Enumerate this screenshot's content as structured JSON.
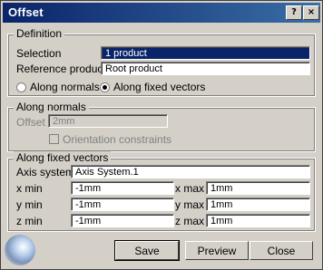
{
  "window": {
    "title": "Offset",
    "help_label": "?",
    "close_label": "×"
  },
  "definition": {
    "group_title": "Definition",
    "selection_label": "Selection",
    "selection_value": "1 product",
    "reference_label": "Reference product",
    "reference_value": "Root product",
    "radio_normals_label": "Along normals",
    "radio_fixed_label": "Along fixed vectors",
    "selected_radio": "Along fixed vectors"
  },
  "along_normals": {
    "group_title": "Along normals",
    "offset_label": "Offset",
    "offset_value": "2mm",
    "orientation_label": "Orientation constraints"
  },
  "along_fixed_vectors": {
    "group_title": "Along fixed vectors",
    "axis_label": "Axis system",
    "axis_value": "Axis System.1",
    "x_min_label": "x min",
    "x_min_value": "-1mm",
    "x_max_label": "x max",
    "x_max_value": "1mm",
    "y_min_label": "y min",
    "y_min_value": "-1mm",
    "y_max_label": "y max",
    "y_max_value": "1mm",
    "z_min_label": "z min",
    "z_min_value": "-1mm",
    "z_max_label": "z max",
    "z_max_value": "1mm"
  },
  "buttons": {
    "save": "Save",
    "preview": "Preview",
    "close": "Close"
  }
}
